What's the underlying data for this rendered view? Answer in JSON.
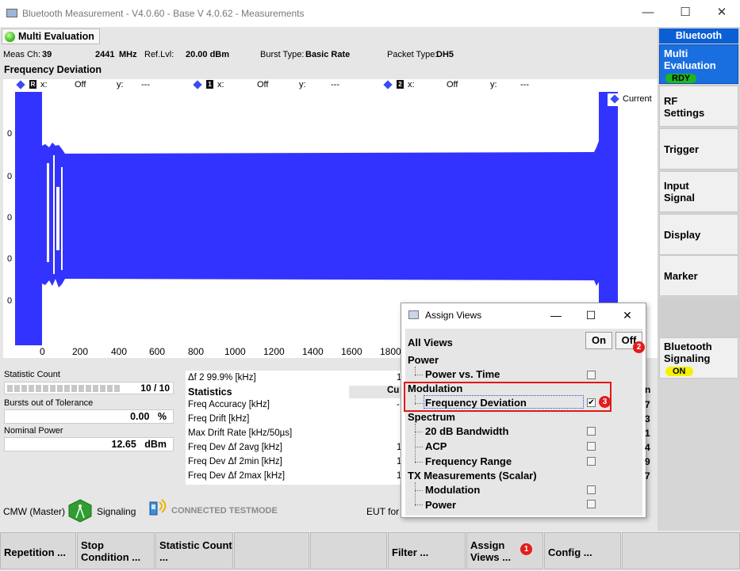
{
  "window": {
    "title": "Bluetooth Measurement  - V4.0.60 - Base V 4.0.62 - Measurements",
    "minimize_glyph": "—",
    "maximize_glyph": "☐",
    "close_glyph": "✕"
  },
  "main": {
    "tab_label": "Multi Evaluation",
    "info": {
      "meas_ch_label": "Meas Ch:",
      "meas_ch_value": "39",
      "freq_value": "2441",
      "freq_unit": "MHz",
      "ref_lvl_label": "Ref.Lvl:",
      "ref_lvl_value": "20.00 dBm",
      "burst_type_label": "Burst Type:",
      "burst_type_value": "Basic Rate",
      "packet_type_label": "Packet Type:",
      "packet_type_value": "DH5"
    },
    "section_title": "Frequency Deviation",
    "markers": [
      {
        "flag": "R",
        "x_label": "x:",
        "x_value": "Off",
        "y_label": "y:",
        "y_value": "---"
      },
      {
        "flag": "1",
        "x_label": "x:",
        "x_value": "Off",
        "y_label": "y:",
        "y_value": "---"
      },
      {
        "flag": "2",
        "x_label": "x:",
        "x_value": "Off",
        "y_label": "y:",
        "y_value": "---"
      }
    ],
    "legend": "Current",
    "y_ticks": [
      "0",
      "0",
      "0",
      "0",
      "0"
    ],
    "x_ticks": [
      "0",
      "200",
      "400",
      "600",
      "800",
      "1000",
      "1200",
      "1400",
      "1600",
      "1800"
    ]
  },
  "chart_data": {
    "type": "area",
    "series": [
      {
        "name": "Current"
      }
    ],
    "x_ticks": [
      0,
      200,
      400,
      600,
      800,
      1000,
      1200,
      1400,
      1600,
      1800
    ]
  },
  "stats": {
    "statistic_count_label": "Statistic Count",
    "statistic_count_value": "10 / 10",
    "statistic_count_fraction": 1.0,
    "bursts_label": "Bursts out of Tolerance",
    "bursts_value": "0.00",
    "bursts_unit": "%",
    "nominal_power_label": "Nominal Power",
    "nominal_power_value": "12.65",
    "nominal_power_unit": "dBm"
  },
  "table": {
    "header_row": "Δf 2 99.9% [kHz]",
    "header_value": "1",
    "statistics_label": "Statistics",
    "current_header": "Cu",
    "rows": [
      {
        "label": "Freq Accuracy [kHz]",
        "value": "-"
      },
      {
        "label": "Freq Drift [kHz]",
        "value": ""
      },
      {
        "label": "Max Drift Rate [kHz/50µs]",
        "value": ""
      },
      {
        "label": "Freq Dev Δf 2avg [kHz]",
        "value": "1"
      },
      {
        "label": "Freq Dev Δf 2min [kHz]",
        "value": "1"
      },
      {
        "label": "Freq Dev Δf 2max [kHz]",
        "value": "1"
      }
    ],
    "right_header": "n",
    "right_values": [
      "7",
      "3",
      "1",
      "4",
      "9",
      "7"
    ]
  },
  "sidebar": {
    "header": "Bluetooth",
    "multi_evaluation": "Multi Evaluation",
    "rdy_badge": "RDY",
    "rf_settings": "RF Settings",
    "trigger": "Trigger",
    "input_signal": "Input Signal",
    "display": "Display",
    "marker": "Marker",
    "bt_signaling": "Bluetooth Signaling",
    "on_badge": "ON"
  },
  "status": {
    "cmw_label": "CMW (Master)",
    "signaling_label": "Signaling",
    "connected_label": "CONNECTED TESTMODE",
    "eut_label": "EUT for"
  },
  "softkeys": {
    "repetition": "Repetition ...",
    "stop_condition": "Stop Condition ...",
    "statistic_count": "Statistic Count ...",
    "filter": "Filter ...",
    "assign_views": "Assign Views ...",
    "config": "Config ..."
  },
  "dialog": {
    "title": "Assign Views",
    "all_views": "All Views",
    "on_label": "On",
    "off_label": "Off",
    "groups": {
      "power": "Power",
      "power_vs_time": "Power vs. Time",
      "modulation": "Modulation",
      "frequency_deviation": "Frequency Deviation",
      "spectrum": "Spectrum",
      "bandwidth_20db": "20 dB Bandwidth",
      "acp": "ACP",
      "frequency_range": "Frequency Range",
      "tx_scalar": "TX Measurements (Scalar)",
      "tx_modulation": "Modulation",
      "tx_power": "Power"
    },
    "checked_glyph": "✔"
  },
  "annotations": {
    "badge1": "1",
    "badge2": "2",
    "badge3": "3",
    "accent": "#e01818"
  },
  "colors": {
    "trace": "#3333ff",
    "sidebar_header": "#0b5fd4",
    "sidebar_active": "#1a6fe0",
    "rdy": "#1fb51f",
    "on_badge": "#f7f000"
  }
}
